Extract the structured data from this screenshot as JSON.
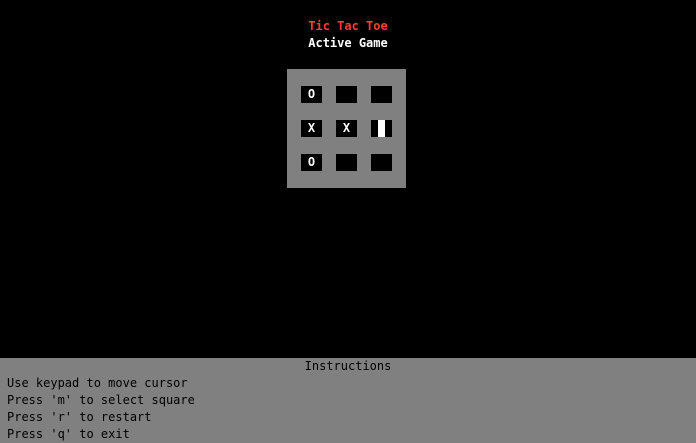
{
  "game": {
    "title": "Tic Tac Toe",
    "status": "Active Game"
  },
  "board": {
    "cells": [
      [
        "O",
        "",
        ""
      ],
      [
        "X",
        "X",
        ""
      ],
      [
        "O",
        "",
        ""
      ]
    ],
    "cursor": {
      "row": 1,
      "col": 2
    }
  },
  "instructions": {
    "title": "Instructions",
    "lines": [
      "Use keypad to move cursor",
      "Press 'm' to select square",
      "Press 'r' to restart",
      "Press 'q' to exit"
    ]
  },
  "colors": {
    "title": "#ff3b3b",
    "status": "#ffffff",
    "board": "#808080",
    "cell": "#000000",
    "panel": "#808080"
  }
}
